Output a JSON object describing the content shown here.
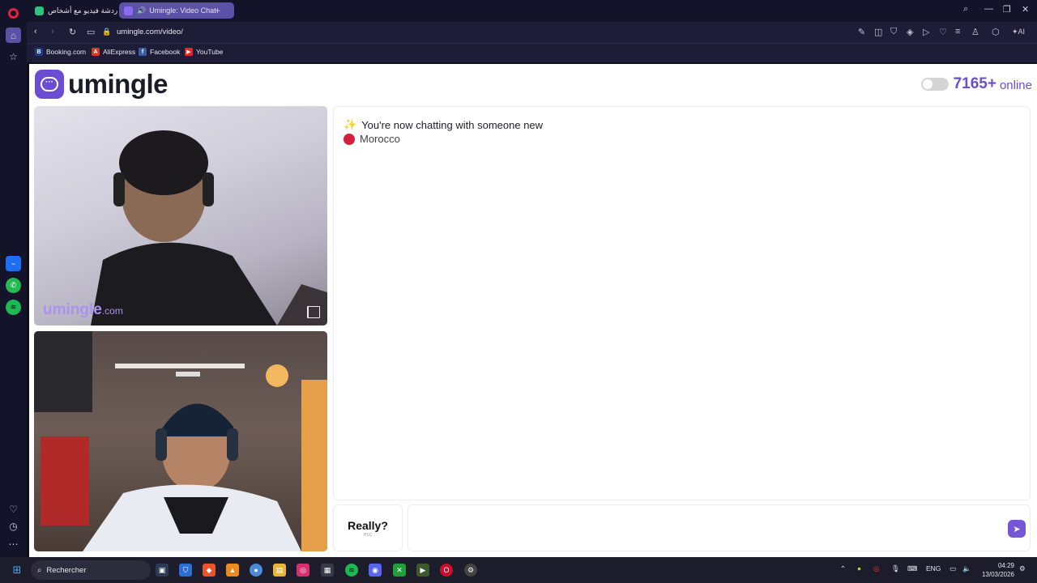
{
  "browser": {
    "tabs": [
      {
        "label": "آزاد دردشة فيديو مع أشخاص"
      },
      {
        "label": "Umingle: Video Chat"
      }
    ],
    "url": "umingle.com/video/",
    "bookmarks": [
      {
        "label": "Booking.com",
        "icon": "B",
        "color": "#1a3b8f"
      },
      {
        "label": "AliExpress",
        "icon": "A",
        "color": "#d53a26"
      },
      {
        "label": "Facebook",
        "icon": "f",
        "color": "#3b5ba5"
      },
      {
        "label": "YouTube",
        "icon": "▶",
        "color": "#e32626"
      }
    ]
  },
  "site": {
    "logo_text": "umingle",
    "online_count": "7165+",
    "online_label": "online",
    "watermark_brand": "umingle",
    "watermark_domain": ".com"
  },
  "chat": {
    "status_message": "You're now chatting with someone new",
    "country": "Morocco",
    "skip_label": "Really?",
    "skip_hint": "esc",
    "input_placeholder": ""
  },
  "taskbar": {
    "search_label": "Rechercher",
    "language": "ENG",
    "time": "04:29",
    "date": "13/03/2026"
  },
  "colors": {
    "brand": "#6a4dd2",
    "country_dot": "#d41f3f"
  }
}
